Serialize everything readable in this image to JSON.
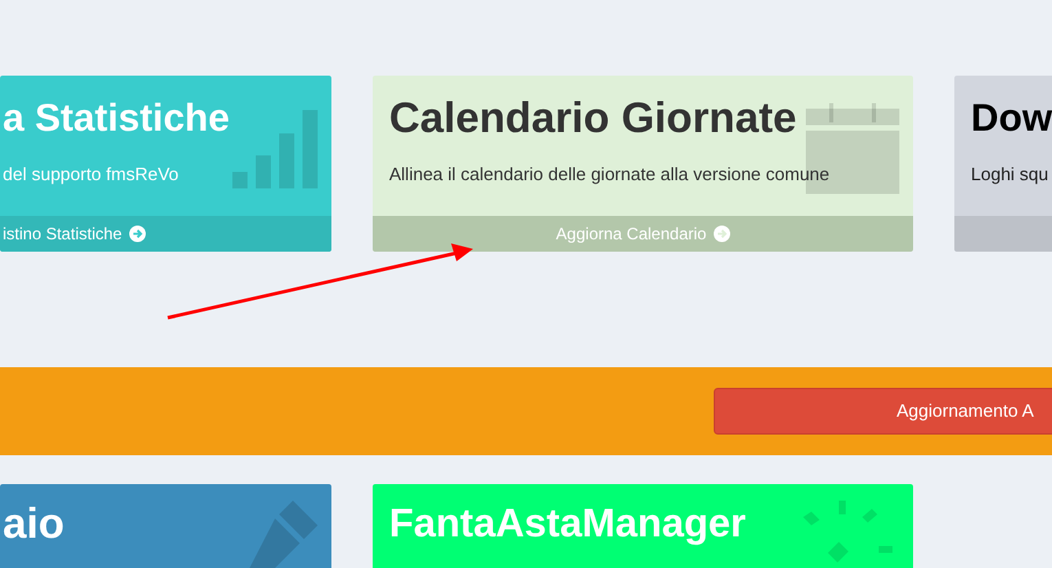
{
  "top_cards": [
    {
      "kind": "statistics",
      "color": "#39cccc",
      "title": "a Statistiche",
      "description": "del supporto fmsReVo",
      "link": "istino Statistiche"
    },
    {
      "kind": "calendar",
      "color": "#dff0d8",
      "title": "Calendario Giornate",
      "description": "Allinea il calendario delle giornate alla versione comune",
      "link": "Aggiorna Calendario"
    },
    {
      "kind": "download",
      "color": "#d2d6de",
      "title": "Dow",
      "description": "Loghi squ"
    }
  ],
  "update_banner": {
    "button": "Aggiornamento A"
  },
  "bottom_cards": [
    {
      "kind": "edit",
      "color": "#3c8dbc",
      "title": "aio"
    },
    {
      "kind": "magic",
      "color": "#00ff73",
      "title": "FantaAstaManager"
    }
  ]
}
